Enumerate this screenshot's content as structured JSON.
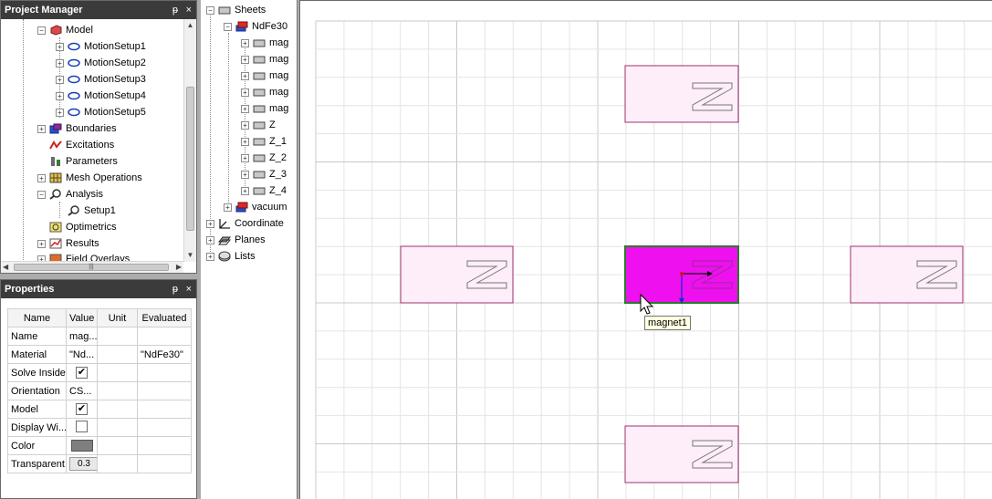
{
  "project_manager": {
    "title": "Project Manager",
    "pin": "ᵽ",
    "close": "×",
    "items": [
      {
        "label": "Model"
      },
      {
        "label": "MotionSetup1"
      },
      {
        "label": "MotionSetup2"
      },
      {
        "label": "MotionSetup3"
      },
      {
        "label": "MotionSetup4"
      },
      {
        "label": "MotionSetup5"
      },
      {
        "label": "Boundaries"
      },
      {
        "label": "Excitations"
      },
      {
        "label": "Parameters"
      },
      {
        "label": "Mesh Operations"
      },
      {
        "label": "Analysis"
      },
      {
        "label": "Setup1"
      },
      {
        "label": "Optimetrics"
      },
      {
        "label": "Results"
      },
      {
        "label": "Field Overlays"
      }
    ]
  },
  "properties": {
    "title": "Properties",
    "pin": "ᵽ",
    "close": "×",
    "columns": [
      "Name",
      "Value",
      "Unit",
      "Evaluated"
    ],
    "rows": [
      {
        "name": "Name",
        "value": "mag...",
        "unit": "",
        "evaluated": ""
      },
      {
        "name": "Material",
        "value": "\"Nd...",
        "unit": "",
        "evaluated": "\"NdFe30\""
      },
      {
        "name": "Solve Inside",
        "value": "✔",
        "unit": "",
        "evaluated": ""
      },
      {
        "name": "Orientation",
        "value": "CS...",
        "unit": "",
        "evaluated": ""
      },
      {
        "name": "Model",
        "value": "✔",
        "unit": "",
        "evaluated": ""
      },
      {
        "name": "Display Wi...",
        "value": "",
        "unit": "",
        "evaluated": ""
      },
      {
        "name": "Color",
        "value": "",
        "unit": "",
        "evaluated": ""
      },
      {
        "name": "Transparent",
        "value": "0.3",
        "unit": "",
        "evaluated": ""
      }
    ]
  },
  "model_tree": {
    "items": [
      {
        "label": "Sheets"
      },
      {
        "label": "NdFe30"
      },
      {
        "label": "mag"
      },
      {
        "label": "mag"
      },
      {
        "label": "mag"
      },
      {
        "label": "mag"
      },
      {
        "label": "mag"
      },
      {
        "label": "Z"
      },
      {
        "label": "Z_1"
      },
      {
        "label": "Z_2"
      },
      {
        "label": "Z_3"
      },
      {
        "label": "Z_4"
      },
      {
        "label": "vacuum"
      },
      {
        "label": "Coordinate"
      },
      {
        "label": "Planes"
      },
      {
        "label": "Lists"
      }
    ]
  },
  "viewport": {
    "tooltip": "magnet1",
    "magnet_label": "Z",
    "colors": {
      "magnet_fill": "#fdeefa",
      "magnet_border": "#a0306c",
      "selected_fill": "#ee10ee",
      "selected_border": "#2a7a2a",
      "grid_minor": "#e4e4e4",
      "grid_major": "#c8c8c8"
    }
  }
}
